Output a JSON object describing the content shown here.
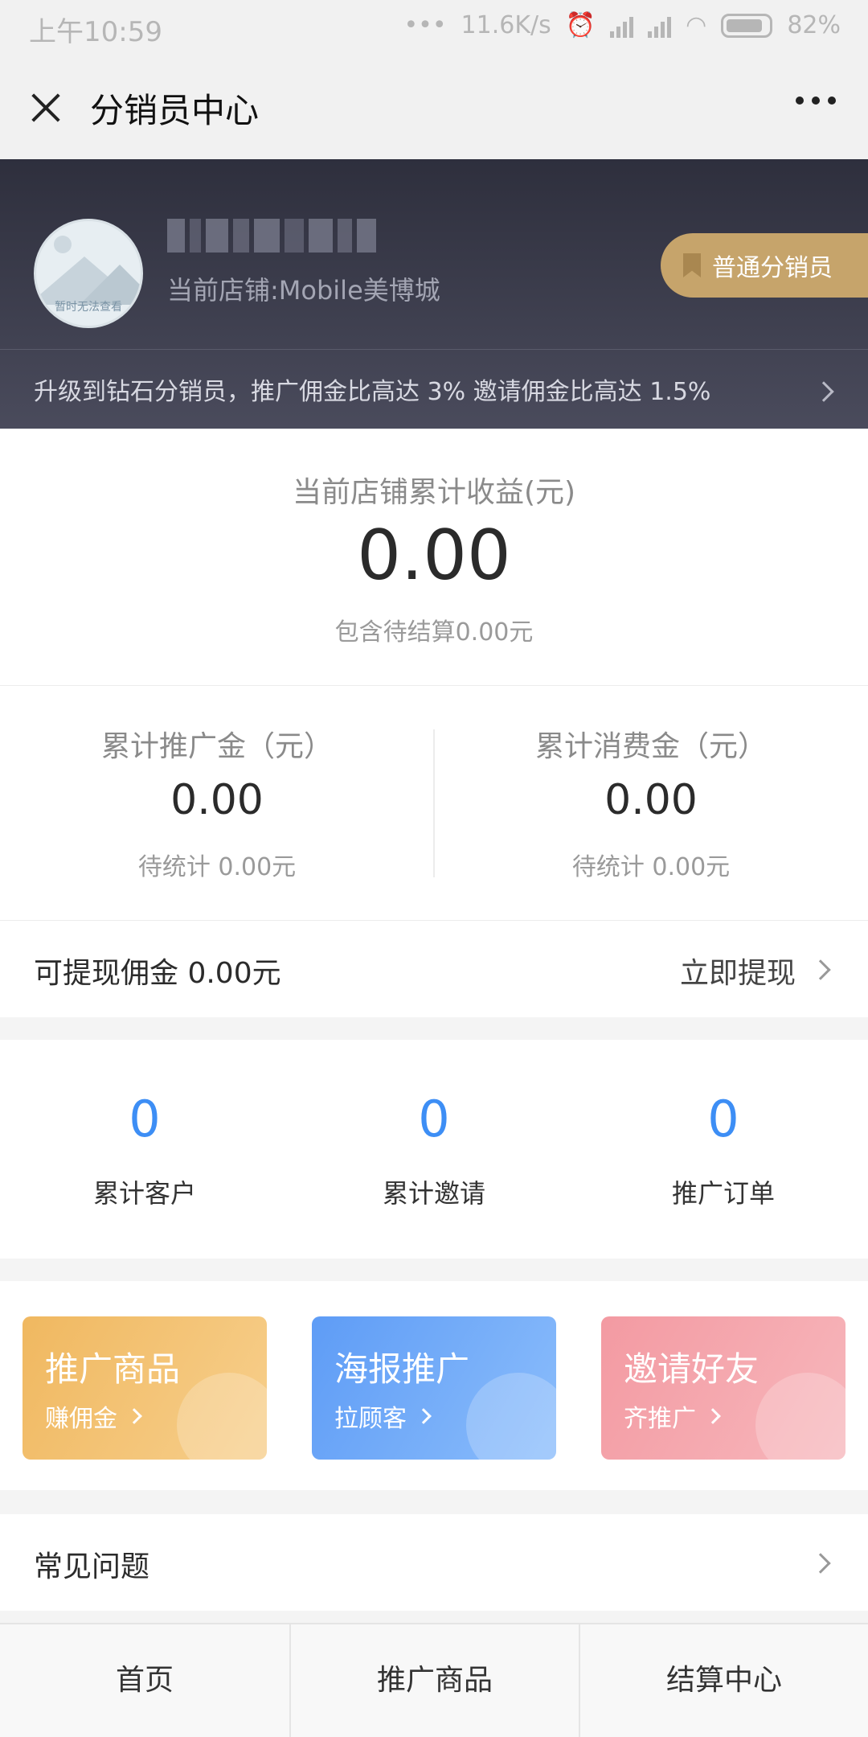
{
  "status_bar": {
    "time": "上午10:59",
    "dots": "•••",
    "speed": "11.6K/s",
    "battery": "82%"
  },
  "header": {
    "title": "分销员中心"
  },
  "profile": {
    "avatar_caption": "暂时无法查看",
    "shop": "当前店铺:Mobile美博城",
    "level_badge": "普通分销员",
    "upgrade_tip": "升级到钻石分销员，推广佣金比高达 3% 邀请佣金比高达 1.5%"
  },
  "earnings": {
    "label": "当前店铺累计收益(元)",
    "value": "0.00",
    "pending": "包含待结算0.00元"
  },
  "stats": [
    {
      "title": "累计推广金（元）",
      "value": "0.00",
      "sub": "待统计 0.00元"
    },
    {
      "title": "累计消费金（元）",
      "value": "0.00",
      "sub": "待统计 0.00元"
    }
  ],
  "withdraw": {
    "label": "可提现佣金 0.00元",
    "action": "立即提现"
  },
  "counts": [
    {
      "value": "0",
      "label": "累计客户"
    },
    {
      "value": "0",
      "label": "累计邀请"
    },
    {
      "value": "0",
      "label": "推广订单"
    }
  ],
  "cards": [
    {
      "title": "推广商品",
      "sub": "赚佣金"
    },
    {
      "title": "海报推广",
      "sub": "拉顾客"
    },
    {
      "title": "邀请好友",
      "sub": "齐推广"
    }
  ],
  "faq": {
    "label": "常见问题"
  },
  "tabs": [
    "首页",
    "推广商品",
    "结算中心"
  ],
  "colors": {
    "accent_blue": "#3d8ef5",
    "gold_badge": "#c6a46b",
    "hero_dark": "#2e2f3d"
  }
}
